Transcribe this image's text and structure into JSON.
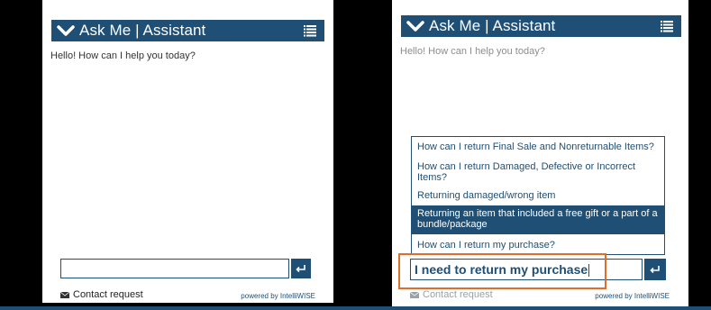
{
  "colors": {
    "brand": "#1f4f74",
    "highlight": "#e06d2a",
    "background": "#000000"
  },
  "left_panel": {
    "title": "Ask Me | Assistant",
    "greeting": "Hello! How can I help you today?",
    "input_value": "",
    "contact_label": "Contact request",
    "powered_by": "powered by IntelliWISE"
  },
  "right_panel": {
    "title": "Ask Me | Assistant",
    "greeting": "Hello! How can I help you today?",
    "suggestions": [
      {
        "text": "How can I return Final Sale and Nonreturnable Items?",
        "active": false
      },
      {
        "text": "How can I return Damaged, Defective or Incorrect Items?",
        "active": false
      },
      {
        "text": "Returning damaged/wrong item",
        "active": false
      },
      {
        "text": "Returning an item that included a free gift or a part of a bundle/package",
        "active": true
      },
      {
        "text": "How can I return my purchase?",
        "active": false
      }
    ],
    "input_value": "I need to return my purchase",
    "contact_label": "Contact request",
    "powered_by": "powered by IntelliWISE"
  },
  "icons": [
    "chevron-down-icon",
    "list-menu-icon",
    "enter-icon",
    "mail-icon"
  ]
}
